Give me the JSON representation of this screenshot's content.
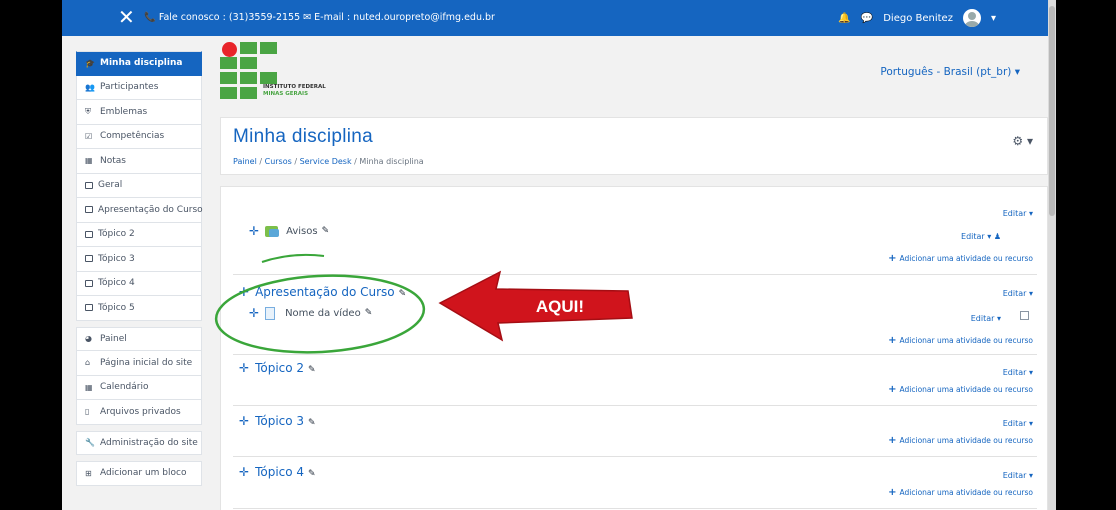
{
  "topbar": {
    "close_glyph": "✕",
    "contact": "📞 Fale conosco : (31)3559-2155 ✉ E-mail : nuted.ouropreto@ifmg.edu.br",
    "bell_icon": "bell-icon",
    "chat_icon": "chat-icon",
    "user_name": "Diego Benitez",
    "caret": "▾"
  },
  "sidebar": {
    "items": [
      {
        "label": "Minha disciplina",
        "icon": "graduation-cap-icon",
        "active": true
      },
      {
        "label": "Participantes",
        "icon": "users-icon"
      },
      {
        "label": "Emblemas",
        "icon": "shield-icon"
      },
      {
        "label": "Competências",
        "icon": "checkbox-icon"
      },
      {
        "label": "Notas",
        "icon": "table-icon"
      },
      {
        "label": "Geral",
        "icon": "folder-icon"
      },
      {
        "label": "Apresentação do Curso",
        "icon": "folder-icon"
      },
      {
        "label": "Tópico 2",
        "icon": "folder-icon"
      },
      {
        "label": "Tópico 3",
        "icon": "folder-icon"
      },
      {
        "label": "Tópico 4",
        "icon": "folder-icon"
      },
      {
        "label": "Tópico 5",
        "icon": "folder-icon"
      }
    ],
    "items2": [
      {
        "label": "Painel",
        "icon": "dashboard-icon"
      },
      {
        "label": "Página inicial do site",
        "icon": "home-icon"
      },
      {
        "label": "Calendário",
        "icon": "calendar-icon"
      },
      {
        "label": "Arquivos privados",
        "icon": "file-icon"
      }
    ],
    "items3": [
      {
        "label": "Administração do site",
        "icon": "wrench-icon"
      }
    ],
    "items4": [
      {
        "label": "Adicionar um bloco",
        "icon": "plus-square-icon"
      }
    ]
  },
  "logo": {
    "line1": "INSTITUTO FEDERAL",
    "line2": "Minas Gerais"
  },
  "language": "Português - Brasil (pt_br) ▾",
  "header": {
    "title": "Minha disciplina",
    "breadcrumb": [
      "Painel",
      "Cursos",
      "Service Desk",
      "Minha disciplina"
    ],
    "sep": "/"
  },
  "sections": [
    {
      "title": "",
      "edit": "Editar ▾",
      "add": "Adicionar uma atividade ou recurso",
      "activity": {
        "name": "Avisos",
        "edit": "Editar ▾ ♟"
      }
    },
    {
      "title": "Apresentação do Curso",
      "edit": "Editar ▾",
      "add": "Adicionar uma atividade ou recurso",
      "activity": {
        "name": "Nome da vídeo",
        "edit": "Editar ▾"
      }
    },
    {
      "title": "Tópico 2",
      "edit": "Editar ▾",
      "add": "Adicionar uma atividade ou recurso"
    },
    {
      "title": "Tópico 3",
      "edit": "Editar ▾",
      "add": "Adicionar uma atividade ou recurso"
    },
    {
      "title": "Tópico 4",
      "edit": "Editar ▾",
      "add": "Adicionar uma atividade ou recurso"
    }
  ],
  "annotation": {
    "label": "AQUI!",
    "arrow_color": "#d0141c",
    "circle_color": "#3aa63a"
  },
  "colors": {
    "accent": "#1565c0",
    "green": "#4aa544"
  }
}
